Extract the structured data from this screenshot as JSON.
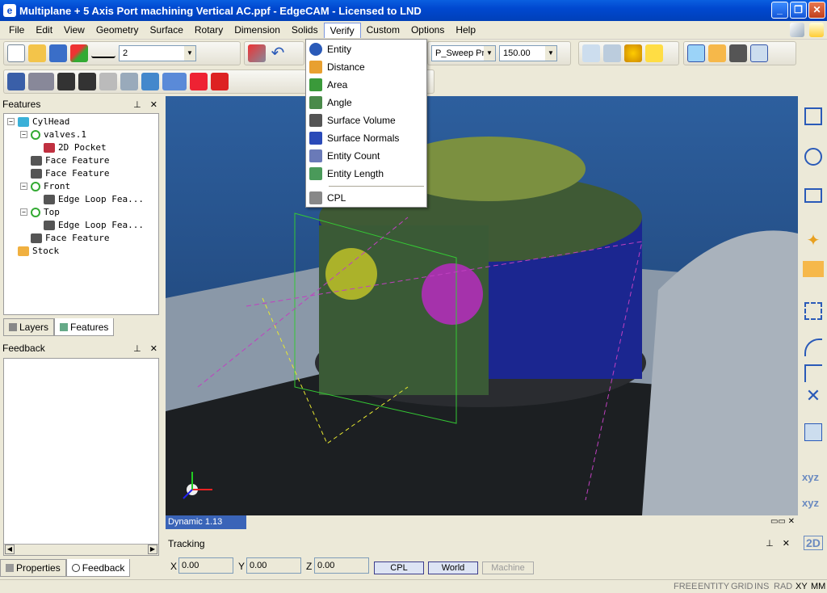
{
  "window": {
    "title": "Multiplane + 5 Axis Port machining Vertical AC.ppf - EdgeCAM - Licensed to LND",
    "app_icon": "edgecam-icon"
  },
  "menu": {
    "items": [
      "File",
      "Edit",
      "View",
      "Geometry",
      "Surface",
      "Rotary",
      "Dimension",
      "Solids",
      "Verify",
      "Custom",
      "Options",
      "Help"
    ],
    "active": "Verify"
  },
  "toolbar": {
    "line_width": "2",
    "sweep_value": "P_Sweep Prof",
    "step_value": "150.00"
  },
  "verify_menu": {
    "items": [
      "Entity",
      "Distance",
      "Area",
      "Angle",
      "Surface Volume",
      "Surface Normals",
      "Entity Count",
      "Entity Length",
      "CPL"
    ]
  },
  "features_panel": {
    "title": "Features",
    "tree": [
      {
        "label": "CylHead",
        "indent": 0,
        "exp": "−",
        "icon": "cube"
      },
      {
        "label": "valves.1",
        "indent": 1,
        "exp": "−",
        "icon": "cpl"
      },
      {
        "label": "2D Pocket",
        "indent": 2,
        "exp": "",
        "icon": "pocket"
      },
      {
        "label": "Face Feature",
        "indent": 1,
        "exp": "",
        "icon": "face"
      },
      {
        "label": "Face Feature",
        "indent": 1,
        "exp": "",
        "icon": "face"
      },
      {
        "label": "Front",
        "indent": 1,
        "exp": "−",
        "icon": "cpl"
      },
      {
        "label": "Edge Loop Fea...",
        "indent": 2,
        "exp": "",
        "icon": "face"
      },
      {
        "label": "Top",
        "indent": 1,
        "exp": "−",
        "icon": "cpl"
      },
      {
        "label": "Edge Loop Fea...",
        "indent": 2,
        "exp": "",
        "icon": "face"
      },
      {
        "label": "Face Feature",
        "indent": 1,
        "exp": "",
        "icon": "face"
      },
      {
        "label": "Stock",
        "indent": 0,
        "exp": "",
        "icon": "stock"
      }
    ],
    "tabs": [
      "Layers",
      "Features"
    ]
  },
  "feedback_panel": {
    "title": "Feedback",
    "tabs": [
      "Properties",
      "Feedback"
    ]
  },
  "viewport": {
    "status": "Dynamic 1.13"
  },
  "tracking": {
    "title": "Tracking",
    "x_label": "X",
    "x_value": "0.00",
    "y_label": "Y",
    "y_value": "0.00",
    "z_label": "Z",
    "z_value": "0.00",
    "buttons": [
      "CPL",
      "World",
      "Machine"
    ]
  },
  "statusbar": {
    "items": [
      "FREE",
      "ENTITY",
      "GRID",
      "INS",
      "RAD",
      "XY",
      "MM"
    ]
  },
  "right_toolbar": {
    "labels": [
      "xyz",
      "xyz",
      "2D"
    ]
  }
}
